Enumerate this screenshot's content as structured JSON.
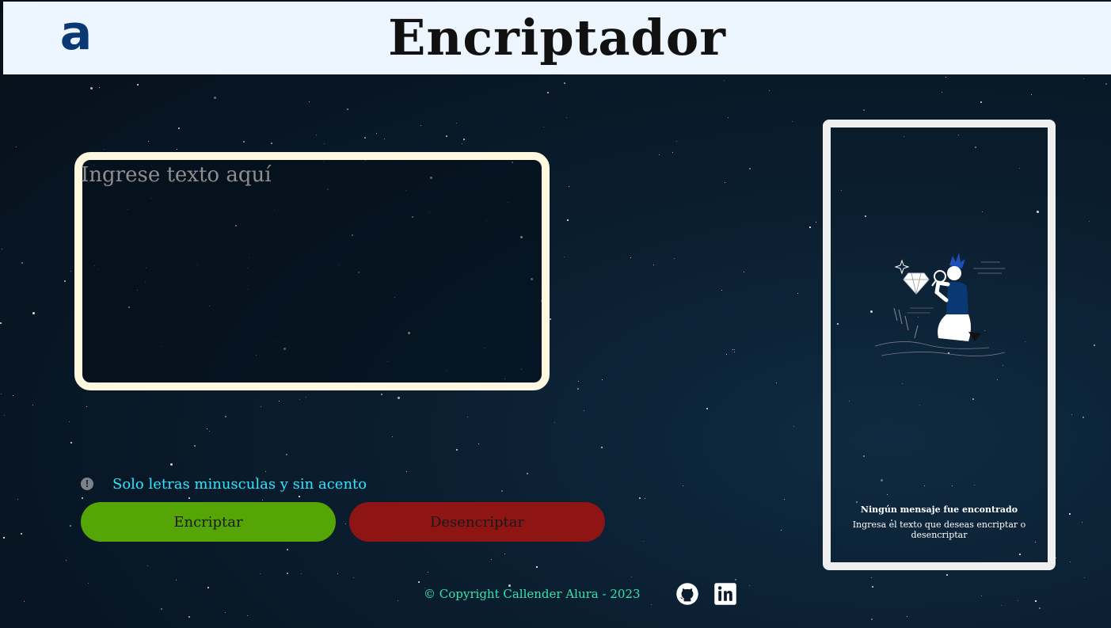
{
  "header": {
    "logo_text": "a",
    "title": "Encriptador"
  },
  "input": {
    "placeholder": "Ingrese texto aquí"
  },
  "note": {
    "icon": "info-icon",
    "text": "Solo letras minusculas y sin acento"
  },
  "buttons": {
    "encrypt_label": "Encriptar",
    "decrypt_label": "Desencriptar"
  },
  "result": {
    "illustration": "searching-person-illustration",
    "title": "Ningún mensaje fue encontrado",
    "subtitle": "Ingresa el texto que deseas encriptar o desencriptar"
  },
  "footer": {
    "copyright": "© Copyright Callender Alura - 2023",
    "social": [
      "github-icon",
      "linkedin-icon"
    ]
  },
  "colors": {
    "header_bg": "#edf5ff",
    "logo": "#0a3873",
    "encrypt_button": "#55a507",
    "decrypt_button": "#8f1515",
    "note_text": "#2ee7ff",
    "footer_text": "#2fe6b0",
    "textbox_border": "#fff8e0"
  }
}
